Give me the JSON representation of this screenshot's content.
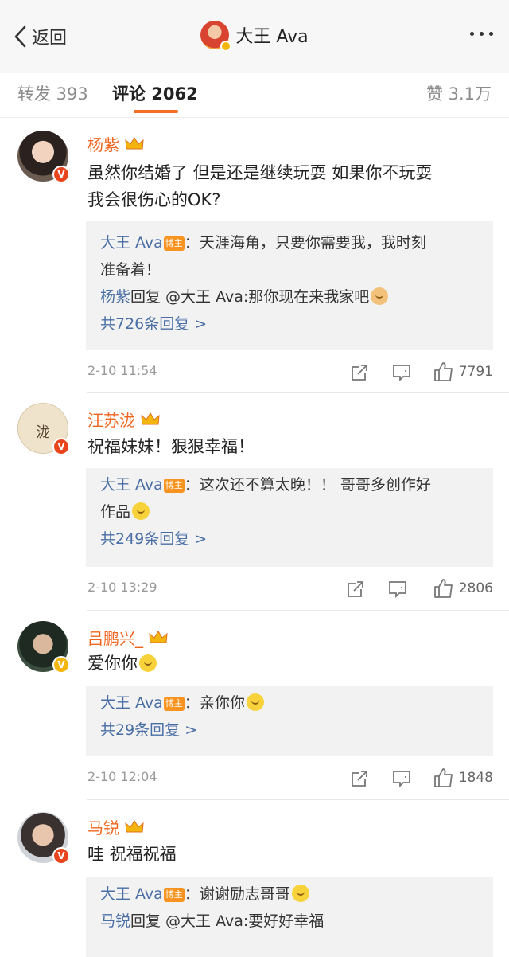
{
  "header": {
    "back_label": "返回",
    "title": "大王 Ava"
  },
  "tabs": {
    "repost": "转发 393",
    "comments": "评论 2062",
    "likes": "赞 3.1万"
  },
  "comments": [
    {
      "user": "杨紫",
      "text_1": "虽然你结婚了 但是还是继续玩耍 如果你不玩耍",
      "text_2": "我会很伤心的OK?",
      "reply1_name": "大王 Ava",
      "reply1_tag": "博主",
      "reply1_text_1": "：天涯海角，只要你需要我，我时刻",
      "reply1_text_2": "准备着！",
      "reply2_name": "杨紫",
      "reply2_text": "回复 @大王 Ava:那你现在来我家吧",
      "more": "共726条回复 >",
      "time": "2-10 11:54",
      "likes": "7791"
    },
    {
      "user": "汪苏泷",
      "text_1": "祝福妹妹！狠狠幸福！",
      "reply1_name": "大王 Ava",
      "reply1_tag": "博主",
      "reply1_text_1": "：这次还不算太晚！！ 哥哥多创作好",
      "reply1_text_2": "作品",
      "more": "共249条回复 >",
      "time": "2-10 13:29",
      "likes": "2806",
      "avatar_text": "泷"
    },
    {
      "user": "吕鹏兴_",
      "text_1": "爱你你",
      "reply1_name": "大王 Ava",
      "reply1_tag": "博主",
      "reply1_text_1": "：亲你你",
      "more": "共29条回复 >",
      "time": "2-10 12:04",
      "likes": "1848"
    },
    {
      "user": "马锐",
      "text_1": "哇 祝福祝福",
      "reply1_name": "大王 Ava",
      "reply1_tag": "博主",
      "reply1_text_1": "：谢谢励志哥哥",
      "reply2_name": "马锐",
      "reply2_text": "回复 @大王 Ava:要好好幸福"
    }
  ],
  "colors": {
    "accent": "#f56c23",
    "username": "#f0651e",
    "link": "#4a6fa5",
    "host_tag": "#f7931e"
  }
}
